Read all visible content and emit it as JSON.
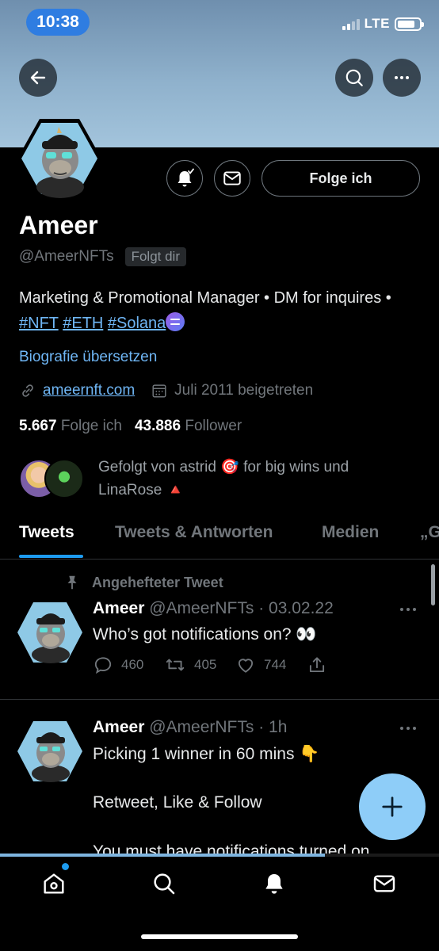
{
  "status_bar": {
    "time": "10:38",
    "network": "LTE",
    "battery_level": 0.8
  },
  "header": {
    "back_icon": "arrow-left-icon",
    "search_icon": "search-icon",
    "more_icon": "more-horizontal-icon"
  },
  "profile": {
    "name": "Ameer",
    "handle": "@AmeerNFTs",
    "follows_you": "Folgt dir",
    "follow_button": "Folge ich",
    "bio_text": "Marketing & Promotional Manager • DM for inquires • ",
    "bio_tags": [
      "#NFT",
      "#ETH",
      "#Solana"
    ],
    "translate_link": "Biografie übersetzen",
    "website": "ameernft.com",
    "joined": "Juli 2011 beigetreten",
    "following_count": "5.667",
    "following_label": "Folge ich",
    "followers_count": "43.886",
    "followers_label": "Follower",
    "followed_by_line1": "Gefolgt von astrid 🎯 for big wins und",
    "followed_by_line2": "LinaRose 🔺"
  },
  "tabs": [
    {
      "label": "Tweets",
      "active": true
    },
    {
      "label": "Tweets & Antworten",
      "active": false
    },
    {
      "label": "Medien",
      "active": false
    },
    {
      "label": "„G",
      "active": false
    }
  ],
  "tweets": [
    {
      "pinned_label": "Angehefteter Tweet",
      "name": "Ameer",
      "handle_time": "@AmeerNFTs · 03.02.22",
      "text": "Who’s got notifications on? 👀",
      "replies": "460",
      "retweets": "405",
      "likes": "744"
    },
    {
      "name": "Ameer",
      "handle_time": "@AmeerNFTs · 1h",
      "line1": "Picking 1 winner in 60 mins 👇",
      "line2": "Retweet, Like & Follow",
      "line3": "You must have notifications turned on"
    }
  ],
  "colors": {
    "accent": "#1d9bf0",
    "link": "#6fb6f5",
    "fab": "#8ecdf8"
  }
}
